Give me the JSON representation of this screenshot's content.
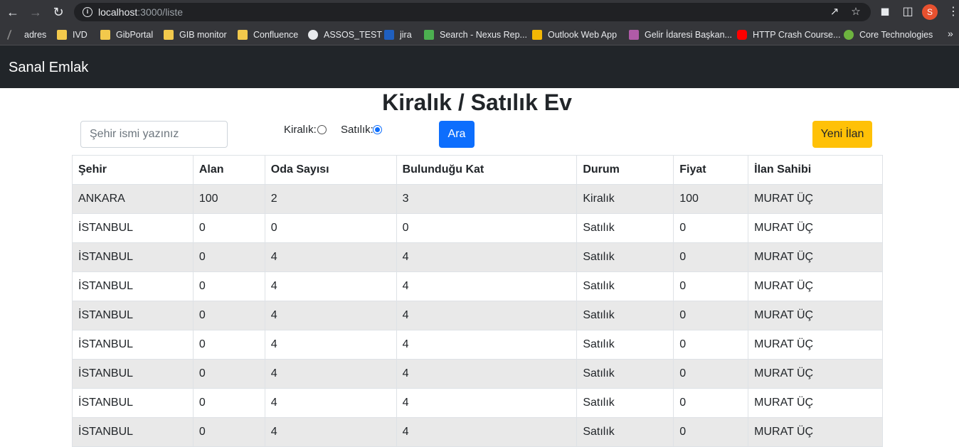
{
  "browser": {
    "url_host": "localhost",
    "url_path": ":3000/liste",
    "profile_initial": "S",
    "bookmarks": [
      {
        "label": "adres",
        "icon": "pen-icon",
        "color": "#3c3c3c"
      },
      {
        "label": "IVD",
        "icon": "folder-icon",
        "color": "#f2c94c"
      },
      {
        "label": "GibPortal",
        "icon": "folder-icon",
        "color": "#f2c94c"
      },
      {
        "label": "GIB monitor",
        "icon": "folder-icon",
        "color": "#f2c94c"
      },
      {
        "label": "Confluence",
        "icon": "folder-icon",
        "color": "#f2c94c"
      },
      {
        "label": "ASSOS_TEST",
        "icon": "globe-icon",
        "color": "#e8eaed"
      },
      {
        "label": "jira",
        "icon": "jira-icon",
        "color": "#1f5fbf"
      },
      {
        "label": "Search - Nexus Rep...",
        "icon": "nexus-icon",
        "color": "#4caf50"
      },
      {
        "label": "Outlook Web App",
        "icon": "outlook-icon",
        "color": "#f2b705"
      },
      {
        "label": "Gelir İdaresi Başkan...",
        "icon": "gib-icon",
        "color": "#b05ba8"
      },
      {
        "label": "HTTP Crash Course...",
        "icon": "youtube-icon",
        "color": "#ff0000"
      },
      {
        "label": "Core Technologies",
        "icon": "spring-icon",
        "color": "#6db33f"
      }
    ]
  },
  "app": {
    "brand": "Sanal Emlak",
    "title": "Kiralık / Satılık Ev",
    "search_placeholder": "Şehir ismi yazınız",
    "radio_rent_label": "Kiralık:",
    "radio_sale_label": "Satılık:",
    "selected": "Satılık",
    "search_button": "Ara",
    "new_button": "Yeni İlan"
  },
  "table": {
    "headers": [
      "Şehir",
      "Alan",
      "Oda Sayısı",
      "Bulunduğu Kat",
      "Durum",
      "Fiyat",
      "İlan Sahibi"
    ],
    "rows": [
      [
        "ANKARA",
        "100",
        "2",
        "3",
        "Kiralık",
        "100",
        "MURAT ÜÇ"
      ],
      [
        "İSTANBUL",
        "0",
        "0",
        "0",
        "Satılık",
        "0",
        "MURAT ÜÇ"
      ],
      [
        "İSTANBUL",
        "0",
        "4",
        "4",
        "Satılık",
        "0",
        "MURAT ÜÇ"
      ],
      [
        "İSTANBUL",
        "0",
        "4",
        "4",
        "Satılık",
        "0",
        "MURAT ÜÇ"
      ],
      [
        "İSTANBUL",
        "0",
        "4",
        "4",
        "Satılık",
        "0",
        "MURAT ÜÇ"
      ],
      [
        "İSTANBUL",
        "0",
        "4",
        "4",
        "Satılık",
        "0",
        "MURAT ÜÇ"
      ],
      [
        "İSTANBUL",
        "0",
        "4",
        "4",
        "Satılık",
        "0",
        "MURAT ÜÇ"
      ],
      [
        "İSTANBUL",
        "0",
        "4",
        "4",
        "Satılık",
        "0",
        "MURAT ÜÇ"
      ],
      [
        "İSTANBUL",
        "0",
        "4",
        "4",
        "Satılık",
        "0",
        "MURAT ÜÇ"
      ]
    ]
  }
}
